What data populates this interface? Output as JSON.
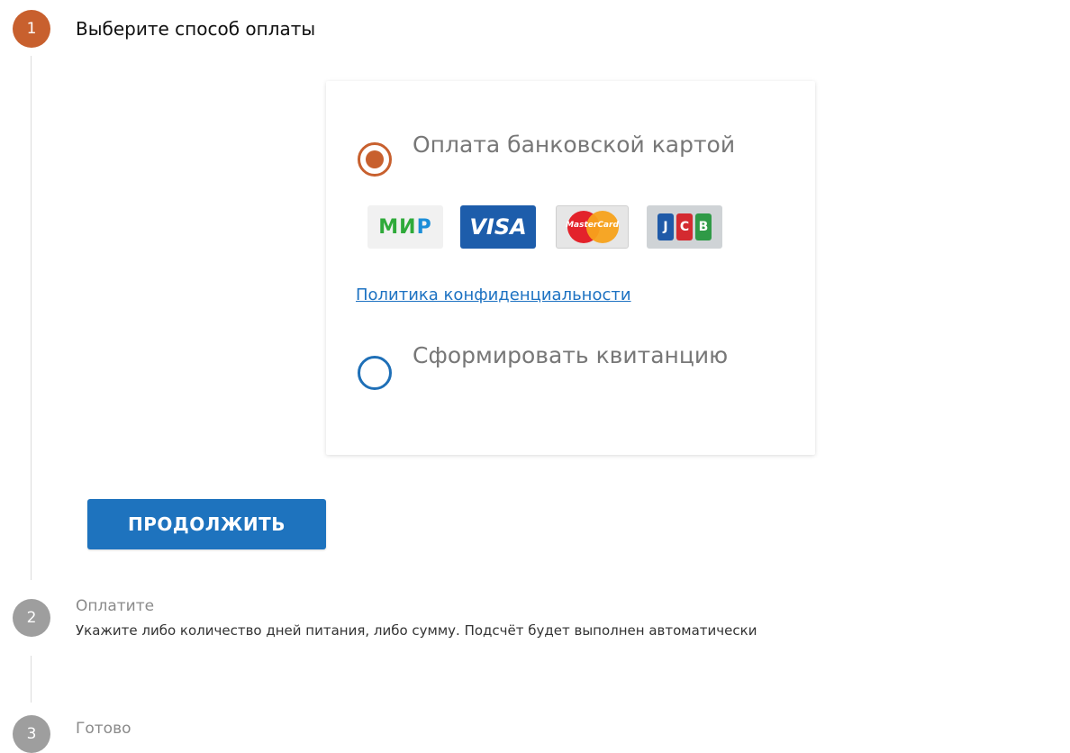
{
  "steps": [
    {
      "number": "1",
      "title": "Выберите способ оплаты",
      "state": "active"
    },
    {
      "number": "2",
      "title": "Оплатите",
      "description": "Укажите либо количество дней питания, либо сумму. Подсчёт будет выполнен автоматически",
      "state": "inactive"
    },
    {
      "number": "3",
      "title": "Готово",
      "state": "inactive"
    }
  ],
  "payment_options": [
    {
      "label": "Оплата банковской картой",
      "selected": true
    },
    {
      "label": "Сформировать квитанцию",
      "selected": false
    }
  ],
  "card_logos": {
    "mir": {
      "main": "МИ",
      "tail": "Р"
    },
    "visa": "VISA",
    "mastercard": "MasterCard",
    "jcb": [
      "J",
      "C",
      "B"
    ]
  },
  "privacy_link": "Политика конфиденциальности",
  "continue_button": "ПРОДОЛЖИТЬ",
  "colors": {
    "active_step": "#c8602e",
    "inactive_step": "#9e9e9e",
    "primary": "#1e73be",
    "link": "#1d72c2"
  }
}
